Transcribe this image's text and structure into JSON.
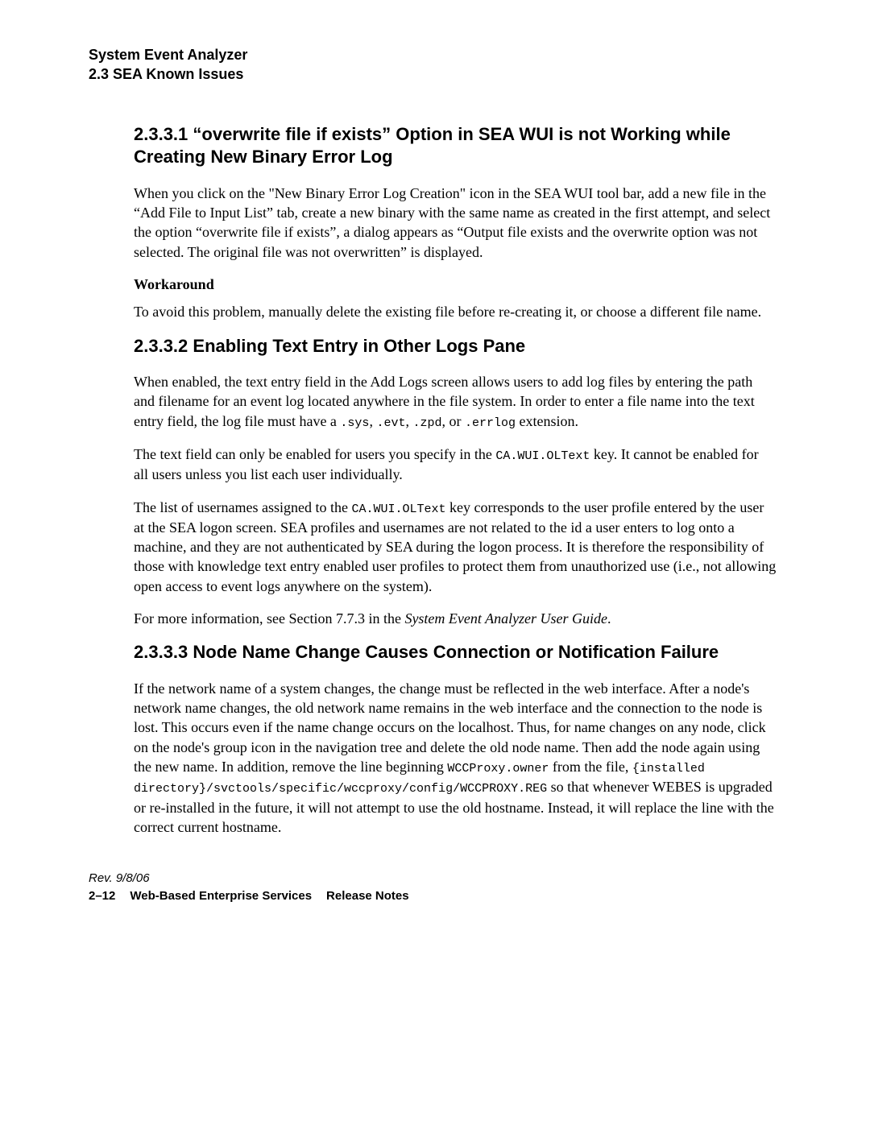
{
  "header": {
    "line1": "System Event Analyzer",
    "line2": "2.3  SEA Known Issues"
  },
  "sections": {
    "s1": {
      "title": "2.3.3.1  “overwrite file if exists” Option in SEA WUI is not Working while Creating New Binary Error Log",
      "p1": "When you click on the \"New Binary Error Log Creation\" icon in the SEA WUI tool bar, add a new file in the “Add File to Input List” tab, create a new binary with the same name as created in the first attempt, and select the option “overwrite file if exists”, a dialog appears as “Output file exists and the overwrite option was not selected. The original file was not overwritten” is displayed.",
      "workaround_label": "Workaround",
      "p2": "To avoid this problem, manually delete the existing file before re-creating it, or choose a different file name."
    },
    "s2": {
      "title": "2.3.3.2  Enabling Text Entry in Other Logs Pane",
      "p1_a": "When enabled, the text entry field in the Add Logs screen allows users to add log files by entering the path and filename for an event log located anywhere in the file system. In order to enter a file name into the text entry field, the log file must have a ",
      "ext1": ".sys",
      "sep1": ", ",
      "ext2": ".evt",
      "sep2": ", ",
      "ext3": ".zpd",
      "sep3": ", or ",
      "ext4": ".errlog",
      "p1_b": " extension.",
      "p2_a": "The text field can only be enabled for users you specify in the ",
      "key1": "CA.WUI.OLText",
      "p2_b": " key. It cannot be enabled for all users unless you list each user individually.",
      "p3_a": "The list of usernames assigned to the ",
      "key2": "CA.WUI.OLText",
      "p3_b": " key corresponds to the user profile entered by the user at the SEA logon screen. SEA profiles and usernames are not related to the id a user enters to log onto a machine, and they are not authenticated by SEA during the logon process. It is therefore the responsibility of those with knowledge text entry enabled user profiles to protect them from unauthorized use (i.e., not allowing open access to event logs anywhere on the system).",
      "p4_a": "For more information, see Section 7.7.3 in the ",
      "p4_em": "System Event Analyzer User Guide",
      "p4_b": "."
    },
    "s3": {
      "title": "2.3.3.3  Node Name Change Causes Connection or Notification Failure",
      "p1_a": "If the network name of a system changes, the change must be reflected in the web interface. After a node's network name changes, the old network name remains in the web interface and the connection to the node is lost. This occurs even if the name change occurs on the localhost. Thus, for name changes on any node, click on the node's group icon in the navigation tree and delete the old node name. Then add the node again using the new name. In addition, remove the line beginning ",
      "code1": "WCCProxy.owner",
      "p1_b": " from the file, ",
      "code2": "{installed directory}/svctools/specific/wccproxy/config/WCCPROXY.REG",
      "p1_c": " so that whenever WEBES is upgraded or re-installed in the future, it will not attempt to use the old hostname. Instead, it will replace the line with the correct current hostname."
    }
  },
  "footer": {
    "rev": "Rev. 9/8/06",
    "page": "2–12",
    "title": "Web-Based Enterprise Services",
    "sub": "Release Notes"
  }
}
